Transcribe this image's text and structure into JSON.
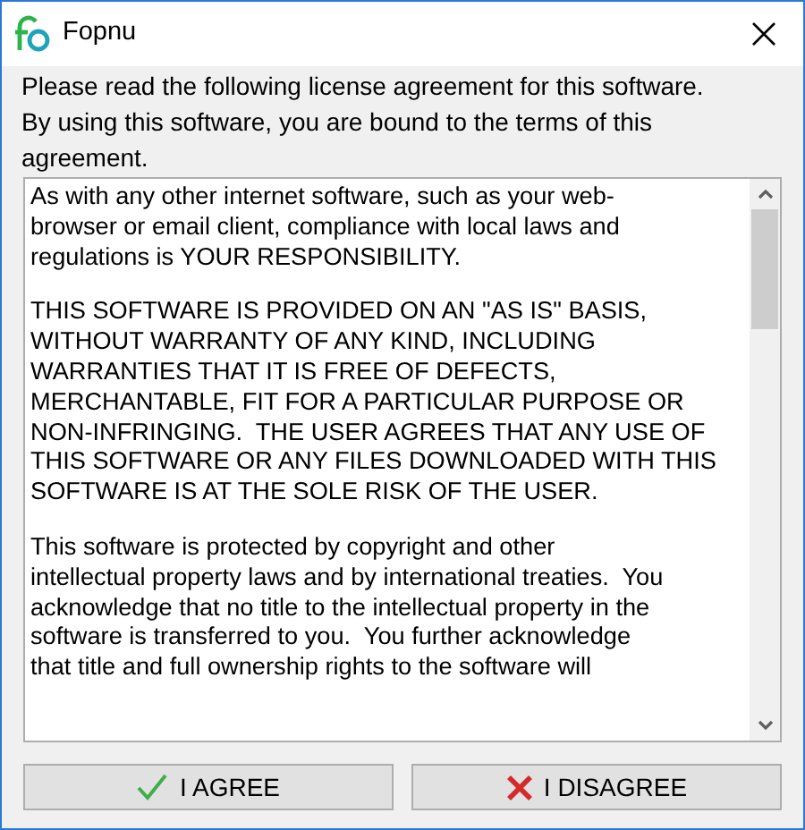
{
  "window": {
    "title": "Fopnu"
  },
  "intro": [
    "Please read the following license agreement for this software.",
    "By using this software, you are bound to the terms of this",
    "agreement."
  ],
  "license": [
    {
      "lines": [
        "As with any other internet software, such as your web-",
        "browser or email client, compliance with local laws and",
        "regulations is YOUR RESPONSIBILITY."
      ]
    },
    {
      "lines": [
        "THIS SOFTWARE IS PROVIDED ON AN \"AS IS\" BASIS,",
        "WITHOUT WARRANTY OF ANY KIND, INCLUDING",
        "WARRANTIES THAT IT IS FREE OF DEFECTS,",
        "MERCHANTABLE, FIT FOR A PARTICULAR PURPOSE OR",
        "NON-INFRINGING.  THE USER AGREES THAT ANY USE OF",
        "THIS SOFTWARE OR ANY FILES DOWNLOADED WITH THIS",
        "SOFTWARE IS AT THE SOLE RISK OF THE USER."
      ]
    },
    {
      "lines": [
        "This software is protected by copyright and other",
        "intellectual property laws and by international treaties.  You",
        "acknowledge that no title to the intellectual property in the",
        "software is transferred to you.  You further acknowledge",
        "that title and full ownership rights to the software will"
      ]
    }
  ],
  "buttons": [
    {
      "kind": "agree",
      "label": "I AGREE"
    },
    {
      "kind": "disagree",
      "label": "I DISAGREE"
    }
  ]
}
